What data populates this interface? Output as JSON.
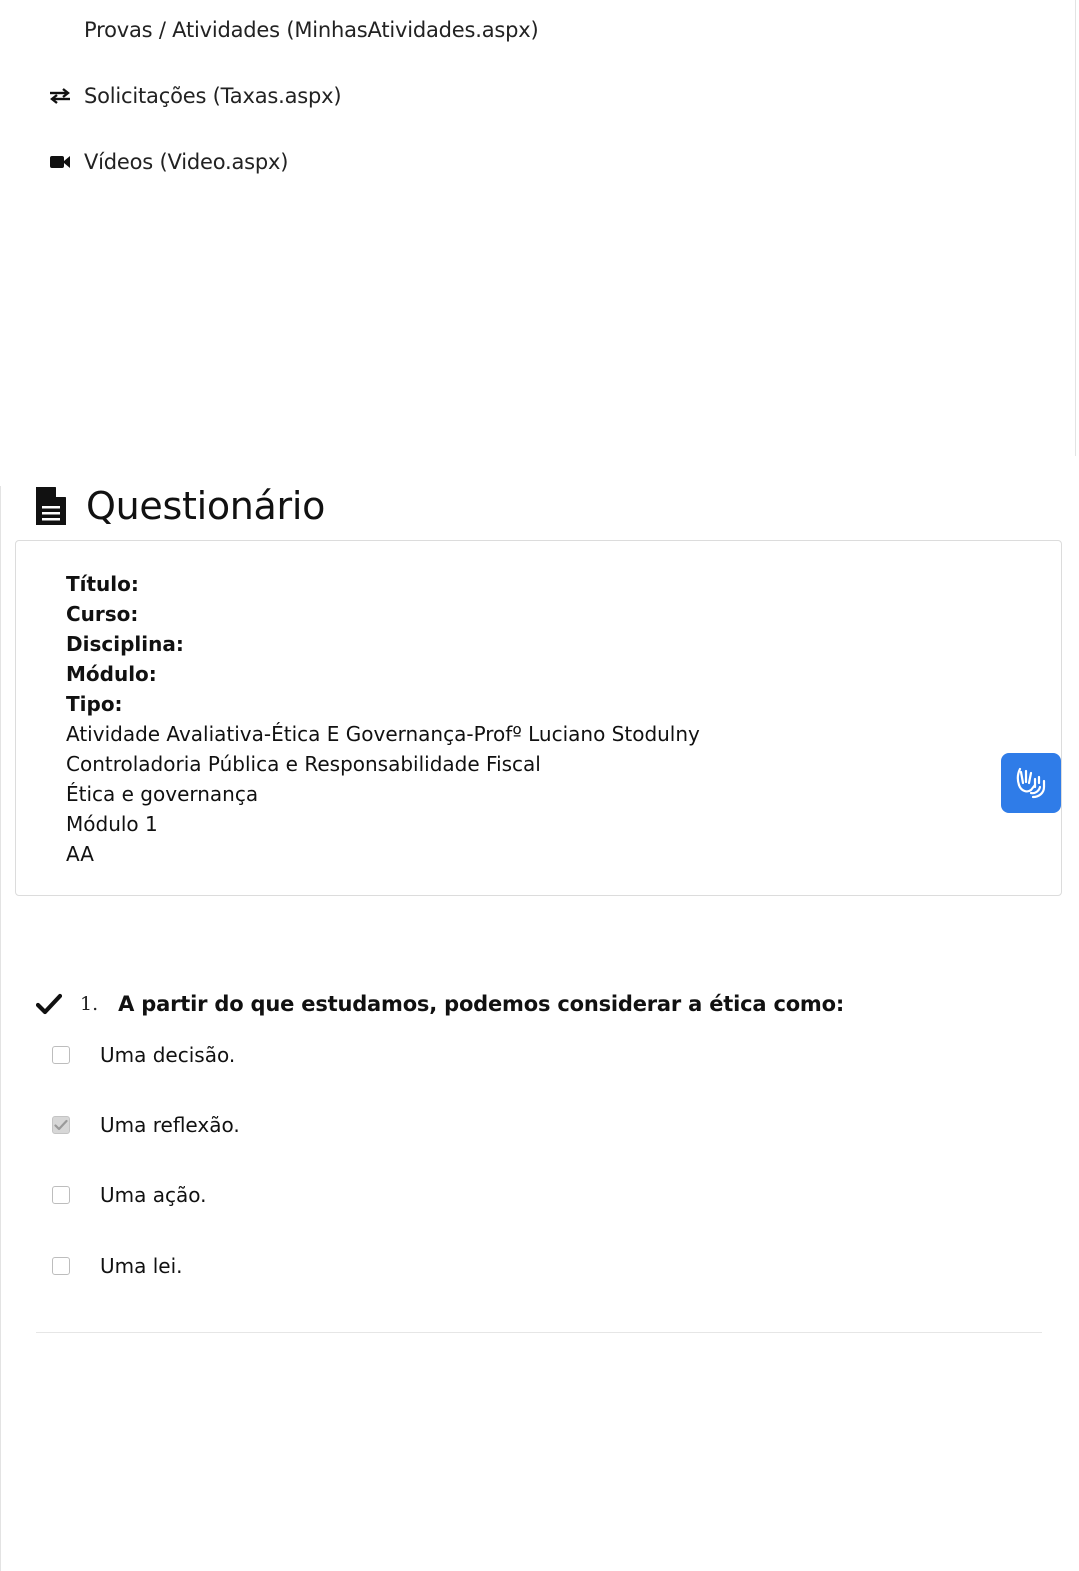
{
  "nav": {
    "items": [
      {
        "label": "Provas / Atividades (MinhasAtividades.aspx)",
        "icon": "none"
      },
      {
        "label": "Solicitações (Taxas.aspx)",
        "icon": "exchange-icon"
      },
      {
        "label": "Vídeos (Video.aspx)",
        "icon": "video-camera-icon"
      }
    ]
  },
  "questionnaire": {
    "title": "Questionário",
    "info": {
      "labels": [
        "Título:",
        "Curso:",
        "Disciplina:",
        "Módulo:",
        "Tipo:"
      ],
      "values": [
        "Atividade Avaliativa-Ética E Governança-Profº Luciano Stodulny",
        "Controladoria Pública e Responsabilidade Fiscal",
        "Ética e governança",
        "Módulo 1",
        "AA"
      ]
    }
  },
  "question": {
    "number": "1.",
    "text": "A partir do que estudamos, podemos considerar a ética como:",
    "options": [
      {
        "label": "Uma decisão.",
        "checked": false
      },
      {
        "label": "Uma reflexão.",
        "checked": true
      },
      {
        "label": "Uma ação.",
        "checked": false
      },
      {
        "label": "Uma lei.",
        "checked": false
      }
    ]
  },
  "colors": {
    "accent": "#2f7ce8",
    "text": "#111111",
    "border": "#dcdcdc"
  }
}
